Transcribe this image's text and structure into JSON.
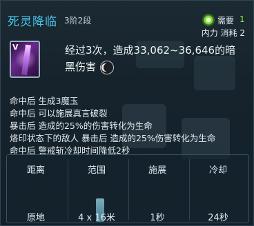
{
  "skill": {
    "name": "死灵降临",
    "stage": "3阶2段",
    "icon_badge": "V"
  },
  "cost": {
    "need_label": "需要",
    "need_value": "1",
    "line": "内力 消耗 2",
    "icon": "energy-orb-icon"
  },
  "description": {
    "line1": "经过3次，造成33,062~36,646的暗",
    "line2": "黑伤害",
    "icon": "dark-moon-icon"
  },
  "effects": [
    "命中后 生成3魔玉",
    "命中后 可以施展真言破裂",
    "暴击后 造成的25%的伤害转化为生命",
    "烙印状态下的敌人 暴击后 造成的25%伤害转化为生命",
    "命中后 警戒斩冷却时间降低2秒"
  ],
  "stats": {
    "headers": [
      "距离",
      "范围",
      "施展",
      "冷却"
    ],
    "values": [
      "原地",
      "4 x 16米",
      "1秒",
      "24秒"
    ]
  },
  "colors": {
    "title": "#49c8ec",
    "need_value": "#8fe84a"
  }
}
